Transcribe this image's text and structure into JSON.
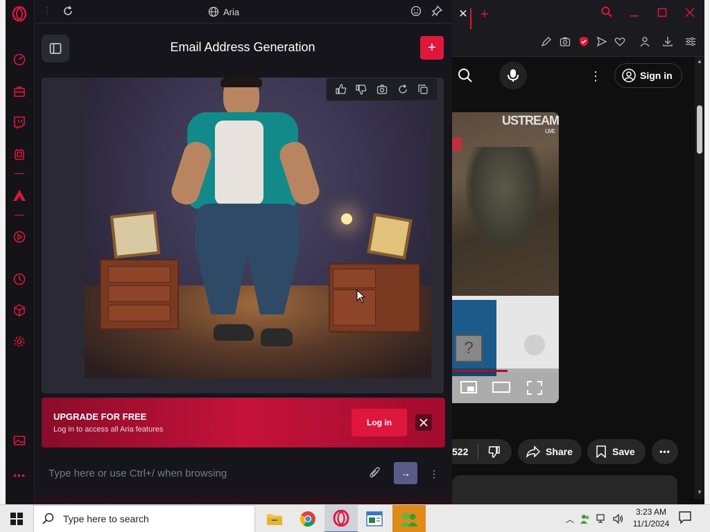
{
  "aria": {
    "app_title": "Aria",
    "chat_title": "Email Address Generation",
    "new_chat_label": "+",
    "upgrade": {
      "heading": "UPGRADE FOR FREE",
      "subtext": "Log in to access all Aria features",
      "login_label": "Log in"
    },
    "composer": {
      "placeholder": "Type here or use Ctrl+/ when browsing",
      "send_label": "→",
      "more_label": "⋮"
    },
    "image_actions": [
      "thumbs-up-icon",
      "thumbs-down-icon",
      "camera-icon",
      "refresh-icon",
      "copy-icon"
    ]
  },
  "youtube": {
    "signin_label": "Sign in",
    "video_logo": "USTREAM",
    "video_logo_sub": "LIVE",
    "likes_count": "522",
    "share_label": "Share",
    "save_label": "Save",
    "more_label": "•••",
    "progress": 0.52
  },
  "taskbar": {
    "search_placeholder": "Type here to search",
    "time": "3:23 AM",
    "date": "11/1/2024"
  },
  "colors": {
    "opera_red": "#e0173d",
    "panel_bg": "#15151b"
  }
}
